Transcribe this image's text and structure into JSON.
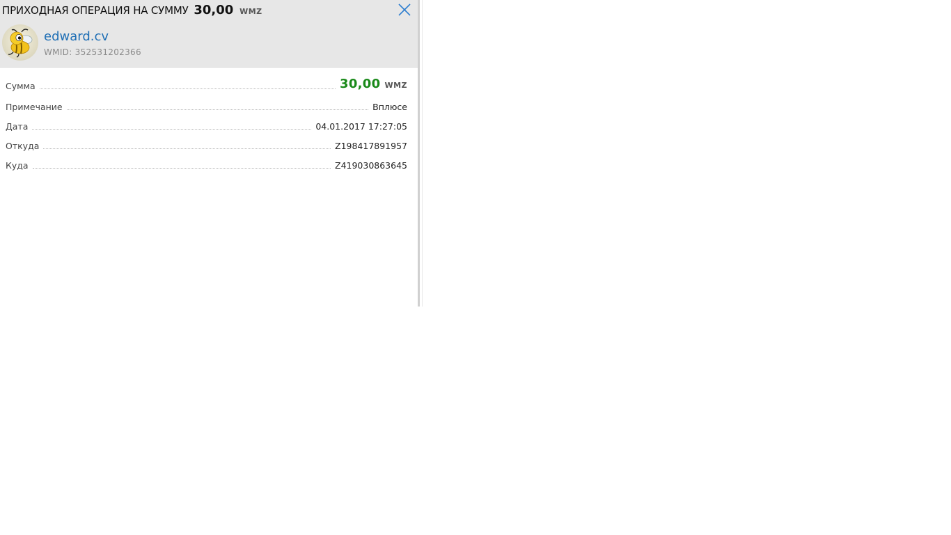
{
  "header": {
    "title": "ПРИХОДНАЯ ОПЕРАЦИЯ НА СУММУ",
    "amount": "30,00",
    "currency": "WMZ",
    "close_icon": "close-icon"
  },
  "user": {
    "avatar_icon": "webmoney-bee-avatar-icon",
    "name": "edward.cv",
    "wmid": "WMID: 352531202366"
  },
  "details": {
    "sum": {
      "label": "Сумма",
      "amount": "30,00",
      "currency": "WMZ"
    },
    "note": {
      "label": "Примечание",
      "value": "Вплюсе"
    },
    "date": {
      "label": "Дата",
      "value": "04.01.2017 17:27:05"
    },
    "from": {
      "label": "Откуда",
      "value": "Z198417891957"
    },
    "to": {
      "label": "Куда",
      "value": "Z419030863645"
    }
  },
  "colors": {
    "header_bg": "#e7e7e7",
    "link": "#1f6fb5",
    "amount_green": "#1a8a1a",
    "close_blue": "#2f7fd0"
  }
}
